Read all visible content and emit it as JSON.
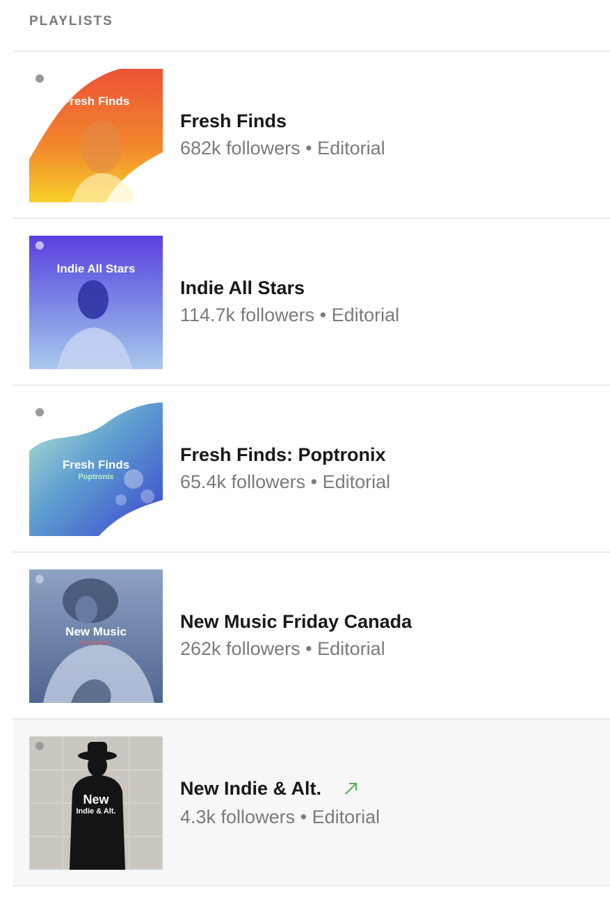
{
  "section": {
    "title": "PLAYLISTS"
  },
  "playlists": [
    {
      "name": "Fresh Finds",
      "followers": "682k followers",
      "separator": "•",
      "type": "Editorial",
      "cover_title": "Fresh Finds",
      "cover_subtitle": "",
      "trending": false
    },
    {
      "name": "Indie All Stars",
      "followers": "114.7k followers",
      "separator": "•",
      "type": "Editorial",
      "cover_title": "Indie All Stars",
      "cover_subtitle": "",
      "trending": false
    },
    {
      "name": "Fresh Finds: Poptronix",
      "followers": "65.4k followers",
      "separator": "•",
      "type": "Editorial",
      "cover_title": "Fresh Finds",
      "cover_subtitle": "Poptronix",
      "trending": false
    },
    {
      "name": "New Music Friday Canada",
      "followers": "262k followers",
      "separator": "•",
      "type": "Editorial",
      "cover_title": "New Music",
      "cover_subtitle": "FRIDAY",
      "trending": false
    },
    {
      "name": "New Indie & Alt.",
      "followers": "4.3k followers",
      "separator": "•",
      "type": "Editorial",
      "cover_title": "New",
      "cover_subtitle": "Indie & Alt.",
      "trending": true
    }
  ],
  "colors": {
    "trend_arrow": "#4caf50",
    "muted_text": "#7a7a7a",
    "highlight_row": "#f7f7f7"
  },
  "icons": {
    "spotify_logo": "spotify-logo-icon",
    "trend": "trending-up-arrow-icon"
  }
}
